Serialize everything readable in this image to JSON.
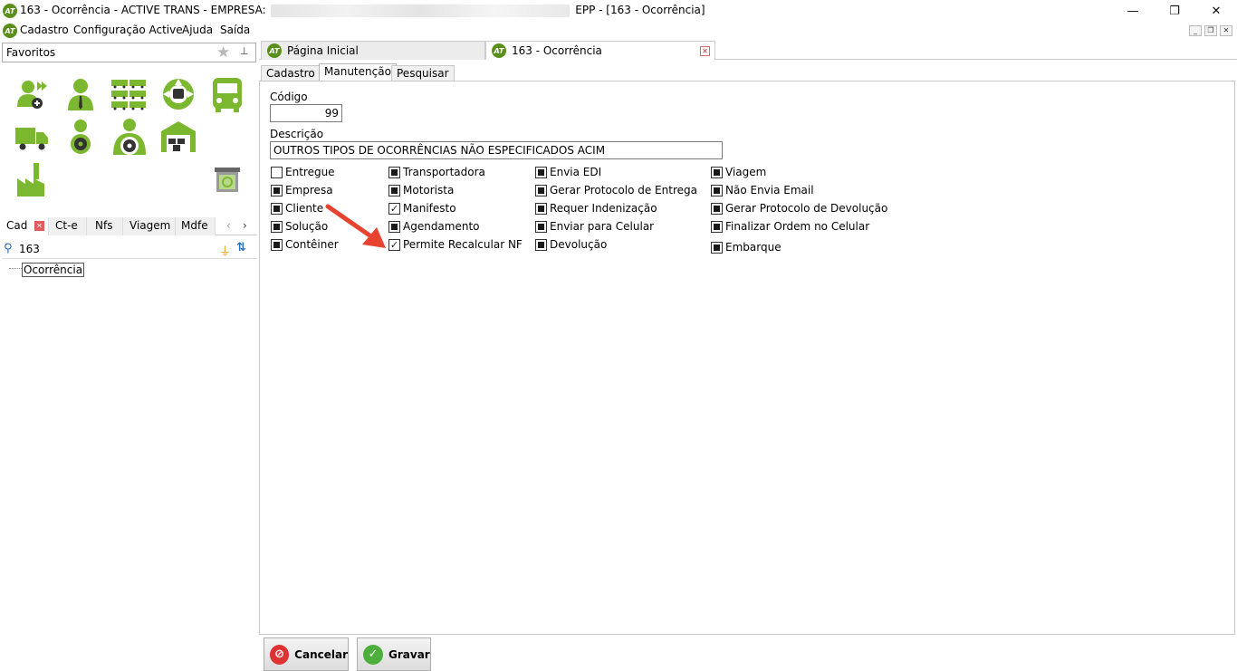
{
  "window": {
    "title_prefix": "163 - Ocorrência - ACTIVE TRANS - EMPRESA:",
    "title_suffix": "EPP - [163 - Ocorrência]",
    "logo_text": "AT"
  },
  "menu": {
    "items": [
      "Cadastro",
      "Configuração Active",
      "Ajuda",
      "Saída"
    ]
  },
  "left": {
    "favorites_label": "Favoritos",
    "tabs": [
      "Cad",
      "Ct-e",
      "Nfs",
      "Viagem",
      "Mdfe"
    ],
    "search_value": "163",
    "tree_item": "Ocorrência",
    "icons": [
      "add-user-icon",
      "person-icon",
      "trucks-icon",
      "wheel-truck-icon",
      "bus-icon",
      "delivery-truck-icon",
      "driver-icon",
      "driver-wheel-icon",
      "warehouse-icon",
      "factory-icon",
      "recycle-bin-icon"
    ]
  },
  "tabs": {
    "home": "Página Inicial",
    "current": "163 - Ocorrência"
  },
  "inner_tabs": [
    "Cadastro",
    "Manutenção",
    "Pesquisar"
  ],
  "form": {
    "codigo_label": "Código",
    "codigo_value": "99",
    "descricao_label": "Descrição",
    "descricao_value": "OUTROS TIPOS DE OCORRÊNCIAS NÃO ESPECIFICADOS ACIM",
    "checkboxes": [
      {
        "label": "Entregue",
        "state": "unchecked"
      },
      {
        "label": "Empresa",
        "state": "indeterminate"
      },
      {
        "label": "Cliente",
        "state": "indeterminate"
      },
      {
        "label": "Solução",
        "state": "indeterminate"
      },
      {
        "label": "Contêiner",
        "state": "indeterminate"
      },
      {
        "label": "Transportadora",
        "state": "indeterminate"
      },
      {
        "label": "Motorista",
        "state": "indeterminate"
      },
      {
        "label": "Manifesto",
        "state": "checked"
      },
      {
        "label": "Agendamento",
        "state": "indeterminate"
      },
      {
        "label": "Permite Recalcular NF",
        "state": "checked"
      },
      {
        "label": "Envia EDI",
        "state": "indeterminate"
      },
      {
        "label": "Gerar Protocolo de Entrega",
        "state": "indeterminate"
      },
      {
        "label": "Requer Indenização",
        "state": "indeterminate"
      },
      {
        "label": "Enviar para Celular",
        "state": "indeterminate"
      },
      {
        "label": "Devolução",
        "state": "indeterminate"
      },
      {
        "label": "Viagem",
        "state": "indeterminate"
      },
      {
        "label": "Não Envia Email",
        "state": "indeterminate"
      },
      {
        "label": "Gerar Protocolo de Devolução",
        "state": "indeterminate"
      },
      {
        "label": "Finalizar Ordem no Celular",
        "state": "indeterminate"
      },
      {
        "label": "Embarque",
        "state": "indeterminate"
      }
    ]
  },
  "buttons": {
    "cancel": "Cancelar",
    "save": "Gravar"
  },
  "colors": {
    "brand_green": "#7cb82f",
    "arrow_red": "#e8432e"
  }
}
